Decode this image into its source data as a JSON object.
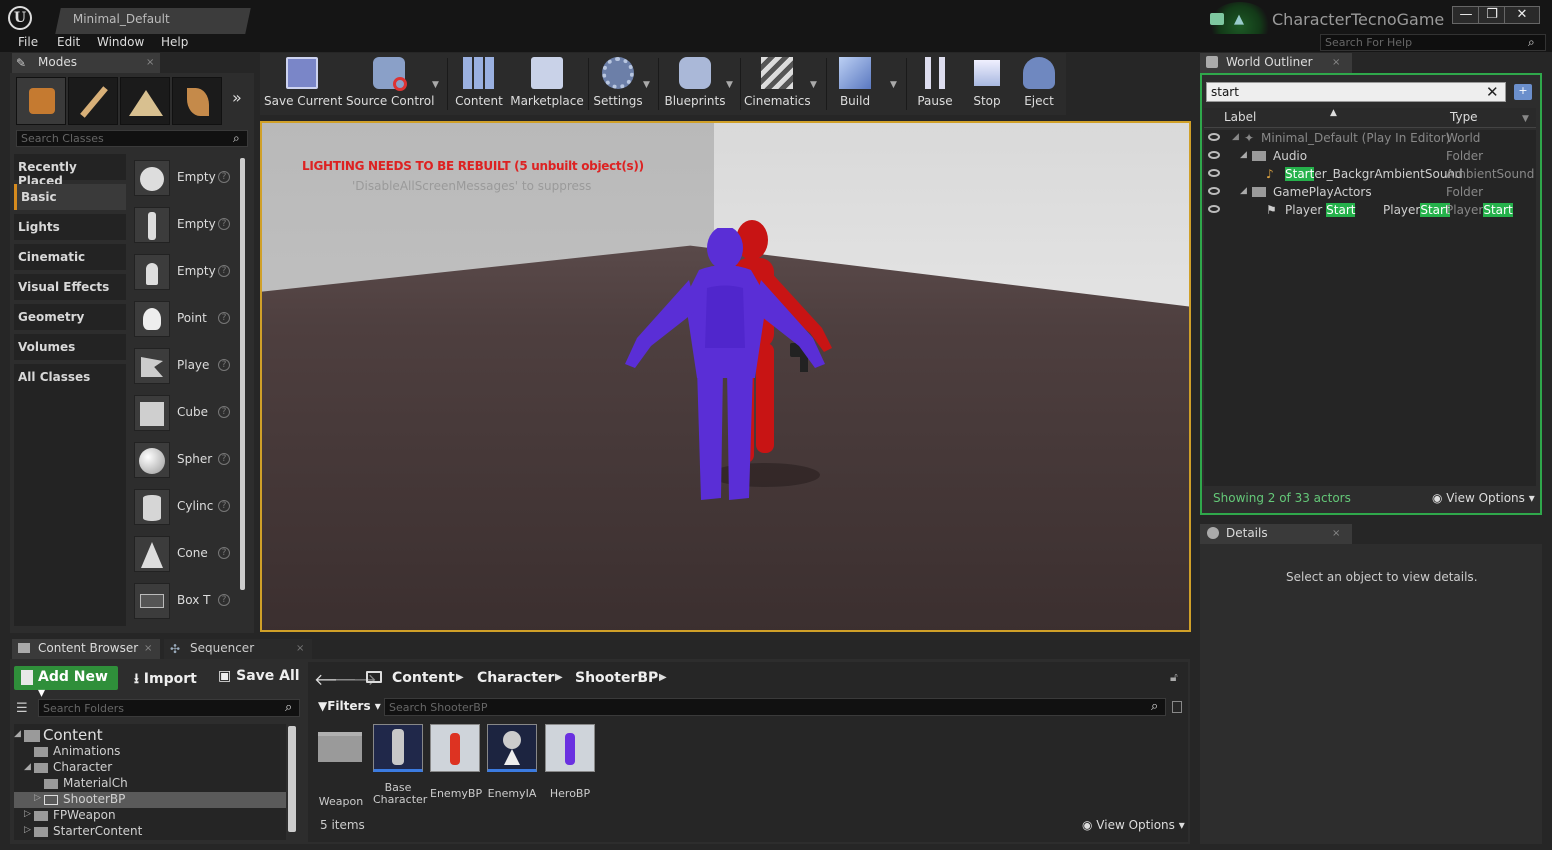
{
  "window": {
    "tab_title": "Minimal_Default",
    "project_name": "CharacterTecnoGame",
    "help_search_placeholder": "Search For Help"
  },
  "menu": [
    "File",
    "Edit",
    "Window",
    "Help"
  ],
  "modes": {
    "tab_label": "Modes",
    "search_placeholder": "Search Classes",
    "categories": [
      "Recently Placed",
      "Basic",
      "Lights",
      "Cinematic",
      "Visual Effects",
      "Geometry",
      "Volumes",
      "All Classes"
    ],
    "selected_category": "Basic",
    "items": [
      "Empty",
      "Empty",
      "Empty",
      "Point",
      "Playe",
      "Cube",
      "Spher",
      "Cylinc",
      "Cone",
      "Box T"
    ]
  },
  "toolbar": {
    "buttons": [
      "Save Current",
      "Source Control",
      "Content",
      "Marketplace",
      "Settings",
      "Blueprints",
      "Cinematics",
      "Build",
      "Pause",
      "Stop",
      "Eject"
    ]
  },
  "viewport": {
    "warning": "LIGHTING NEEDS TO BE REBUILT (5 unbuilt object(s))",
    "suppress": "'DisableAllScreenMessages' to suppress"
  },
  "outliner": {
    "tab_label": "World Outliner",
    "search_value": "start",
    "col_label": "Label",
    "col_type": "Type",
    "rows": [
      {
        "label": "Minimal_Default (Play In Editor)",
        "type": "World"
      },
      {
        "label": "Audio",
        "type": "Folder"
      },
      {
        "label_hl": "Start",
        "label_rest": "er_BackgrAmbientSound",
        "type": "AmbientSound"
      },
      {
        "label": "GamePlayActors",
        "type": "Folder"
      },
      {
        "label_pre": "Player ",
        "label_hl": "Start",
        "type_pre": "Player",
        "type_hl": "Start",
        "type2_pre": "Player",
        "type2_hl": "Start"
      }
    ],
    "status": "Showing 2 of 33 actors",
    "view_options": "View Options"
  },
  "details": {
    "tab_label": "Details",
    "message": "Select an object to view details."
  },
  "content_browser": {
    "tab_label": "Content Browser",
    "sequencer_tab": "Sequencer",
    "add_new": "Add New",
    "import": "Import",
    "save_all": "Save All",
    "folder_search_placeholder": "Search Folders",
    "tree": [
      "Content",
      "Animations",
      "Character",
      "MaterialCh",
      "ShooterBP",
      "FPWeapon",
      "StarterContent"
    ],
    "breadcrumb": [
      "Content",
      "Character",
      "ShooterBP"
    ],
    "filters": "Filters",
    "asset_search_placeholder": "Search ShooterBP",
    "assets": [
      {
        "name": "Weapon"
      },
      {
        "name": "Base Character"
      },
      {
        "name": "EnemyBP"
      },
      {
        "name": "EnemyIA"
      },
      {
        "name": "HeroBP"
      }
    ],
    "items_count": "5 items",
    "view_options": "View Options"
  },
  "colors": {
    "accent": "#d0a028",
    "highlight": "#25b14b",
    "add_new": "#2f8f3a",
    "warning": "#d22222"
  }
}
